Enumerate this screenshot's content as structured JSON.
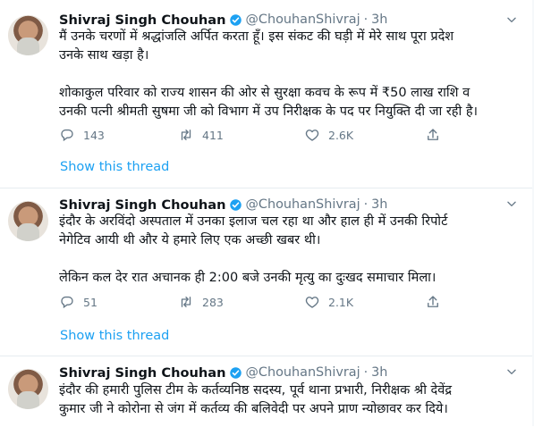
{
  "tweets": [
    {
      "name": "Shivraj Singh Chouhan",
      "handle": "@ChouhanShivraj",
      "separator": "·",
      "time": "3h",
      "text": "मैं उनके चरणों में श्रद्धांजलि अर्पित करता हूँ। इस संकट की घड़ी में मेरे साथ पूरा प्रदेश\nउनके साथ खड़ा है।\n\nशोकाकुल परिवार को राज्य शासन की ओर से सुरक्षा कवच के रूप में ₹50 लाख राशि व\nउनकी पत्नी श्रीमती सुषमा जी को विभाग में उप निरीक्षक के पद पर नियुक्ति दी जा रही है।",
      "replies": "143",
      "retweets": "411",
      "likes": "2.6K",
      "thread_link": "Show this thread"
    },
    {
      "name": "Shivraj Singh Chouhan",
      "handle": "@ChouhanShivraj",
      "separator": "·",
      "time": "3h",
      "text": "इंदौर के अरविंदो अस्पताल में उनका इलाज चल रहा था और हाल ही में उनकी रिपोर्ट\nनेगेटिव आयी थी और ये हमारे लिए एक अच्छी खबर थी।\n\nलेकिन कल देर रात अचानक ही 2:00 बजे उनकी मृत्यु का दुःखद समाचार मिला।",
      "replies": "51",
      "retweets": "283",
      "likes": "2.1K",
      "thread_link": "Show this thread"
    },
    {
      "name": "Shivraj Singh Chouhan",
      "handle": "@ChouhanShivraj",
      "separator": "·",
      "time": "3h",
      "text": "इंदौर की हमारी पुलिस टीम के कर्तव्यनिष्ठ सदस्य, पूर्व थाना प्रभारी, निरीक्षक श्री देवेंद्र\nकुमार जी ने कोरोना से जंग में कर्तव्य की बलिवेदी पर अपने प्राण न्योछावर कर दिये।"
    }
  ],
  "icons": {
    "verified": "verified-badge-icon",
    "more": "chevron-down-icon",
    "reply": "reply-icon",
    "retweet": "retweet-icon",
    "like": "heart-icon",
    "share": "share-icon"
  },
  "colors": {
    "accent": "#1da1f2",
    "text": "#0f1419",
    "muted": "#657786",
    "divider": "#e6ecf0"
  }
}
